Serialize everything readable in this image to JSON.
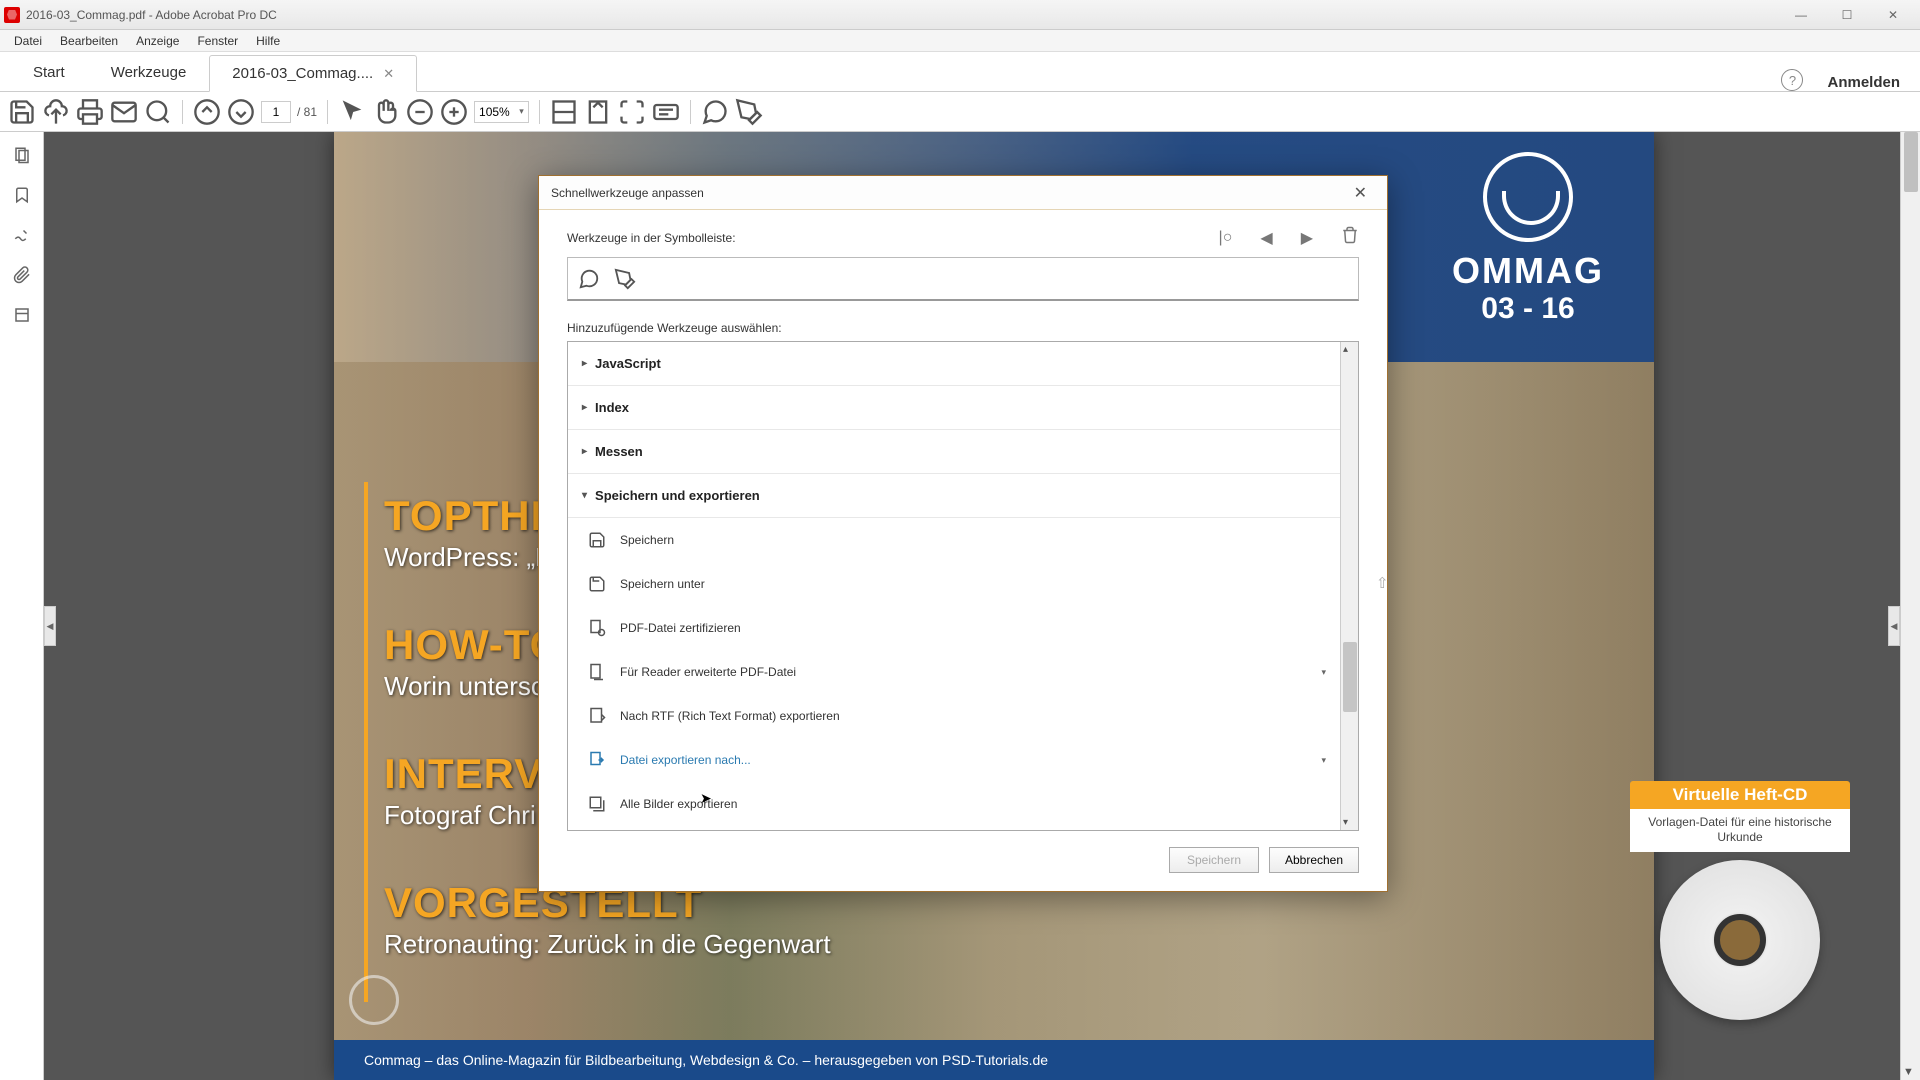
{
  "window": {
    "title": "2016-03_Commag.pdf - Adobe Acrobat Pro DC",
    "minimize": "—",
    "maximize": "☐",
    "close": "✕"
  },
  "menu": [
    "Datei",
    "Bearbeiten",
    "Anzeige",
    "Fenster",
    "Hilfe"
  ],
  "tabs": {
    "start": "Start",
    "tools": "Werkzeuge",
    "doc": "2016-03_Commag....",
    "help": "?",
    "signin": "Anmelden"
  },
  "toolbar": {
    "page_current": "1",
    "page_total": "/ 81",
    "zoom": "105%"
  },
  "document": {
    "logo_text": "OMMAG",
    "logo_sub": "03 - 16",
    "sections": [
      {
        "title": "TOPTHEM",
        "sub": "WordPress: „M"
      },
      {
        "title": "HOW-TO",
        "sub": "Worin untersc"
      },
      {
        "title": "INTERVIE",
        "sub": "Fotograf Chri"
      },
      {
        "title": "VORGESTELLT",
        "sub": "Retronauting: Zurück in die Gegenwart"
      }
    ],
    "cd": {
      "title": "Virtuelle Heft-CD",
      "sub": "Vorlagen-Datei für eine historische Urkunde"
    },
    "footer": "Commag – das Online-Magazin für Bildbearbeitung, Webdesign & Co. – herausgegeben von PSD-Tutorials.de"
  },
  "dialog": {
    "title": "Schnellwerkzeuge anpassen",
    "label_toolbar": "Werkzeuge in der Symbolleiste:",
    "label_add": "Hinzuzufügende Werkzeuge auswählen:",
    "categories": [
      {
        "label": "JavaScript",
        "expanded": false
      },
      {
        "label": "Index",
        "expanded": false
      },
      {
        "label": "Messen",
        "expanded": false
      },
      {
        "label": "Speichern und exportieren",
        "expanded": true
      }
    ],
    "items": [
      {
        "label": "Speichern",
        "icon": "save",
        "submenu": false,
        "selected": false
      },
      {
        "label": "Speichern unter",
        "icon": "save-as",
        "submenu": false,
        "selected": false
      },
      {
        "label": "PDF-Datei zertifizieren",
        "icon": "certify",
        "submenu": false,
        "selected": false
      },
      {
        "label": "Für Reader erweiterte PDF-Datei",
        "icon": "reader",
        "submenu": true,
        "selected": false
      },
      {
        "label": "Nach RTF (Rich Text Format) exportieren",
        "icon": "rtf",
        "submenu": false,
        "selected": false
      },
      {
        "label": "Datei exportieren nach...",
        "icon": "export",
        "submenu": true,
        "selected": true
      },
      {
        "label": "Alle Bilder exportieren",
        "icon": "images",
        "submenu": false,
        "selected": false
      }
    ],
    "save": "Speichern",
    "cancel": "Abbrechen"
  }
}
